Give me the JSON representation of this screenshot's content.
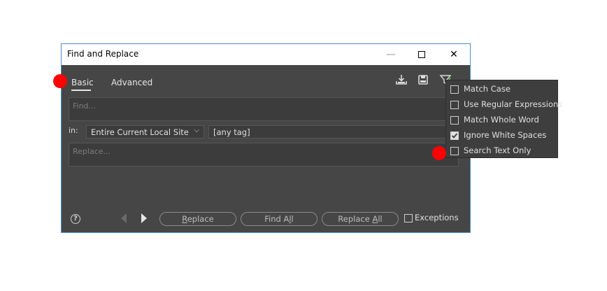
{
  "window": {
    "title": "Find and Replace"
  },
  "tabs": [
    {
      "label": "Basic",
      "active": true
    },
    {
      "label": "Advanced",
      "active": false
    }
  ],
  "toolbar": {
    "icons": [
      "download-icon",
      "save-icon",
      "filter-icon"
    ]
  },
  "find": {
    "placeholder": "Find..."
  },
  "scope": {
    "in_label": "in:",
    "selected": "Entire Current Local Site",
    "tag_value": "[any tag]"
  },
  "replace": {
    "placeholder": "Replace..."
  },
  "buttons": {
    "replace_pre": "",
    "replace_u": "R",
    "replace_post": "eplace",
    "findall_pre": "Find A",
    "findall_u": "l",
    "findall_post": "l",
    "replaceall_pre": "Replace ",
    "replaceall_u": "A",
    "replaceall_post": "ll"
  },
  "exceptions": {
    "label": "Exceptions",
    "checked": false
  },
  "options": [
    {
      "label": "Match Case",
      "checked": false
    },
    {
      "label": "Use Regular Expressions",
      "checked": false
    },
    {
      "label": "Match Whole Word",
      "checked": false
    },
    {
      "label": "Ignore White Spaces",
      "checked": true
    },
    {
      "label": "Search Text Only",
      "checked": false
    }
  ],
  "colors": {
    "panel": "#464646",
    "dropdown": "#3e3e3e",
    "marker": "#ff0000",
    "accent_border": "#4a8fcf"
  }
}
